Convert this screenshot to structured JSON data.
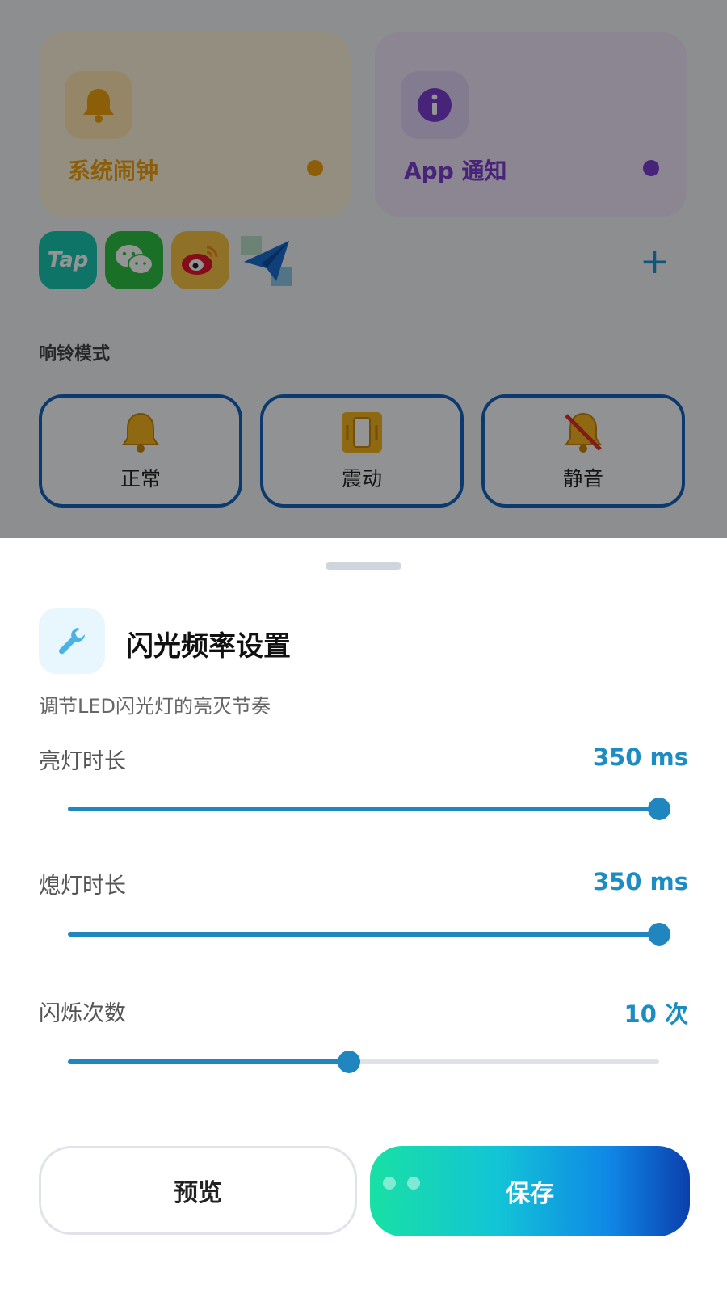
{
  "background": {
    "cards": {
      "alarm": {
        "title": "系统闹钟",
        "icon": "bell-icon",
        "color": "#f2a20f"
      },
      "notification": {
        "title": "App 通知",
        "icon": "info-icon",
        "color": "#7a3fd1"
      }
    },
    "apps": [
      {
        "name": "Tap",
        "icon": "taptap-icon"
      },
      {
        "name": "",
        "icon": "wechat-icon"
      },
      {
        "name": "",
        "icon": "weibo-icon"
      },
      {
        "name": "",
        "icon": "paper-plane-icon"
      }
    ],
    "add_icon": "plus-icon",
    "ring_mode": {
      "label": "响铃模式",
      "modes": [
        {
          "label": "正常",
          "icon": "bell-icon"
        },
        {
          "label": "震动",
          "icon": "vibrate-icon"
        },
        {
          "label": "静音",
          "icon": "bell-muted-icon"
        }
      ]
    }
  },
  "sheet": {
    "title": "闪光频率设置",
    "subtitle": "调节LED闪光灯的亮灭节奏",
    "icon": "wrench-icon",
    "accent_color": "#1f86c0",
    "sliders": [
      {
        "label": "亮灯时长",
        "value_text": "350 ms",
        "fraction": 1.0
      },
      {
        "label": "熄灯时长",
        "value_text": "350 ms",
        "fraction": 1.0
      },
      {
        "label": "闪烁次数",
        "value_text": "10 次",
        "fraction": 0.475
      }
    ],
    "buttons": {
      "preview": "预览",
      "save": "保存"
    }
  }
}
